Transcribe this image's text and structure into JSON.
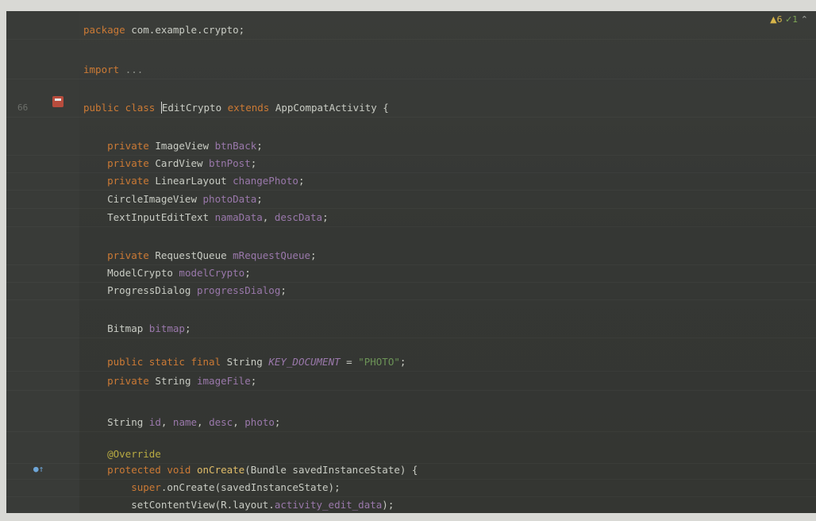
{
  "status": {
    "warnings": "▲6",
    "checks": "✓1",
    "up": "⌃"
  },
  "lines": [
    {
      "number": "",
      "tokens": [
        [
          "package ",
          "kw"
        ],
        [
          "com.example.crypto;",
          "plain"
        ]
      ]
    },
    {
      "number": "",
      "tokens": [
        [
          "import ",
          "kw"
        ],
        [
          "...",
          "gray"
        ]
      ]
    },
    {
      "number": "66",
      "tokens": [
        [
          "public class ",
          "kw"
        ],
        [
          "EditCrypto",
          "caret"
        ],
        [
          " extends ",
          "kw"
        ],
        [
          "AppCompatActivity {",
          "plain"
        ]
      ]
    },
    {
      "number": "",
      "tokens": [
        [
          "    private ",
          "kw"
        ],
        [
          "ImageView ",
          "plain"
        ],
        [
          "btnBack",
          "field"
        ],
        [
          ";",
          "plain"
        ]
      ]
    },
    {
      "number": "",
      "tokens": [
        [
          "    private ",
          "kw"
        ],
        [
          "CardView ",
          "plain"
        ],
        [
          "btnPost",
          "field"
        ],
        [
          ";",
          "plain"
        ]
      ]
    },
    {
      "number": "",
      "tokens": [
        [
          "    private ",
          "kw"
        ],
        [
          "LinearLayout ",
          "plain"
        ],
        [
          "changePhoto",
          "field"
        ],
        [
          ";",
          "plain"
        ]
      ]
    },
    {
      "number": "",
      "tokens": [
        [
          "    CircleImageView ",
          "plain"
        ],
        [
          "photoData",
          "field"
        ],
        [
          ";",
          "plain"
        ]
      ]
    },
    {
      "number": "",
      "tokens": [
        [
          "    TextInputEditText ",
          "plain"
        ],
        [
          "namaData",
          "field"
        ],
        [
          ", ",
          "plain"
        ],
        [
          "descData",
          "field"
        ],
        [
          ";",
          "plain"
        ]
      ]
    },
    {
      "number": "",
      "tokens": [
        [
          "    private ",
          "kw"
        ],
        [
          "RequestQueue ",
          "plain"
        ],
        [
          "mRequestQueue",
          "field"
        ],
        [
          ";",
          "plain"
        ]
      ]
    },
    {
      "number": "",
      "tokens": [
        [
          "    ModelCrypto ",
          "plain"
        ],
        [
          "modelCrypto",
          "field"
        ],
        [
          ";",
          "plain"
        ]
      ]
    },
    {
      "number": "",
      "tokens": [
        [
          "    ProgressDialog ",
          "plain"
        ],
        [
          "progressDialog",
          "field"
        ],
        [
          ";",
          "plain"
        ]
      ]
    },
    {
      "number": "",
      "tokens": [
        [
          "    Bitmap ",
          "plain"
        ],
        [
          "bitmap",
          "field"
        ],
        [
          ";",
          "plain"
        ]
      ]
    },
    {
      "number": "",
      "tokens": [
        [
          "    public static final ",
          "kw"
        ],
        [
          "String ",
          "plain"
        ],
        [
          "KEY_DOCUMENT",
          "const"
        ],
        [
          " = ",
          "plain"
        ],
        [
          "\"PHOTO\"",
          "str"
        ],
        [
          ";",
          "plain"
        ]
      ]
    },
    {
      "number": "",
      "tokens": [
        [
          "    private ",
          "kw"
        ],
        [
          "String ",
          "plain"
        ],
        [
          "imageFile",
          "field"
        ],
        [
          ";",
          "plain"
        ]
      ]
    },
    {
      "number": "",
      "tokens": [
        [
          "    String ",
          "plain"
        ],
        [
          "id",
          "field"
        ],
        [
          ", ",
          "plain"
        ],
        [
          "name",
          "field"
        ],
        [
          ", ",
          "plain"
        ],
        [
          "desc",
          "field"
        ],
        [
          ", ",
          "plain"
        ],
        [
          "photo",
          "field"
        ],
        [
          ";",
          "plain"
        ]
      ]
    },
    {
      "number": "",
      "tokens": [
        [
          "    @Override",
          "ann"
        ]
      ]
    },
    {
      "number": "",
      "tokens": [
        [
          "    protected void ",
          "kw"
        ],
        [
          "onCreate",
          "fn"
        ],
        [
          "(Bundle savedInstanceState) {",
          "plain"
        ]
      ]
    },
    {
      "number": "",
      "tokens": [
        [
          "        super",
          "kw"
        ],
        [
          ".onCreate(savedInstanceState);",
          "plain"
        ]
      ]
    },
    {
      "number": "",
      "tokens": [
        [
          "        setContentView(R.layout.",
          "plain"
        ],
        [
          "activity_edit_data",
          "field"
        ],
        [
          ");",
          "plain"
        ]
      ]
    }
  ]
}
